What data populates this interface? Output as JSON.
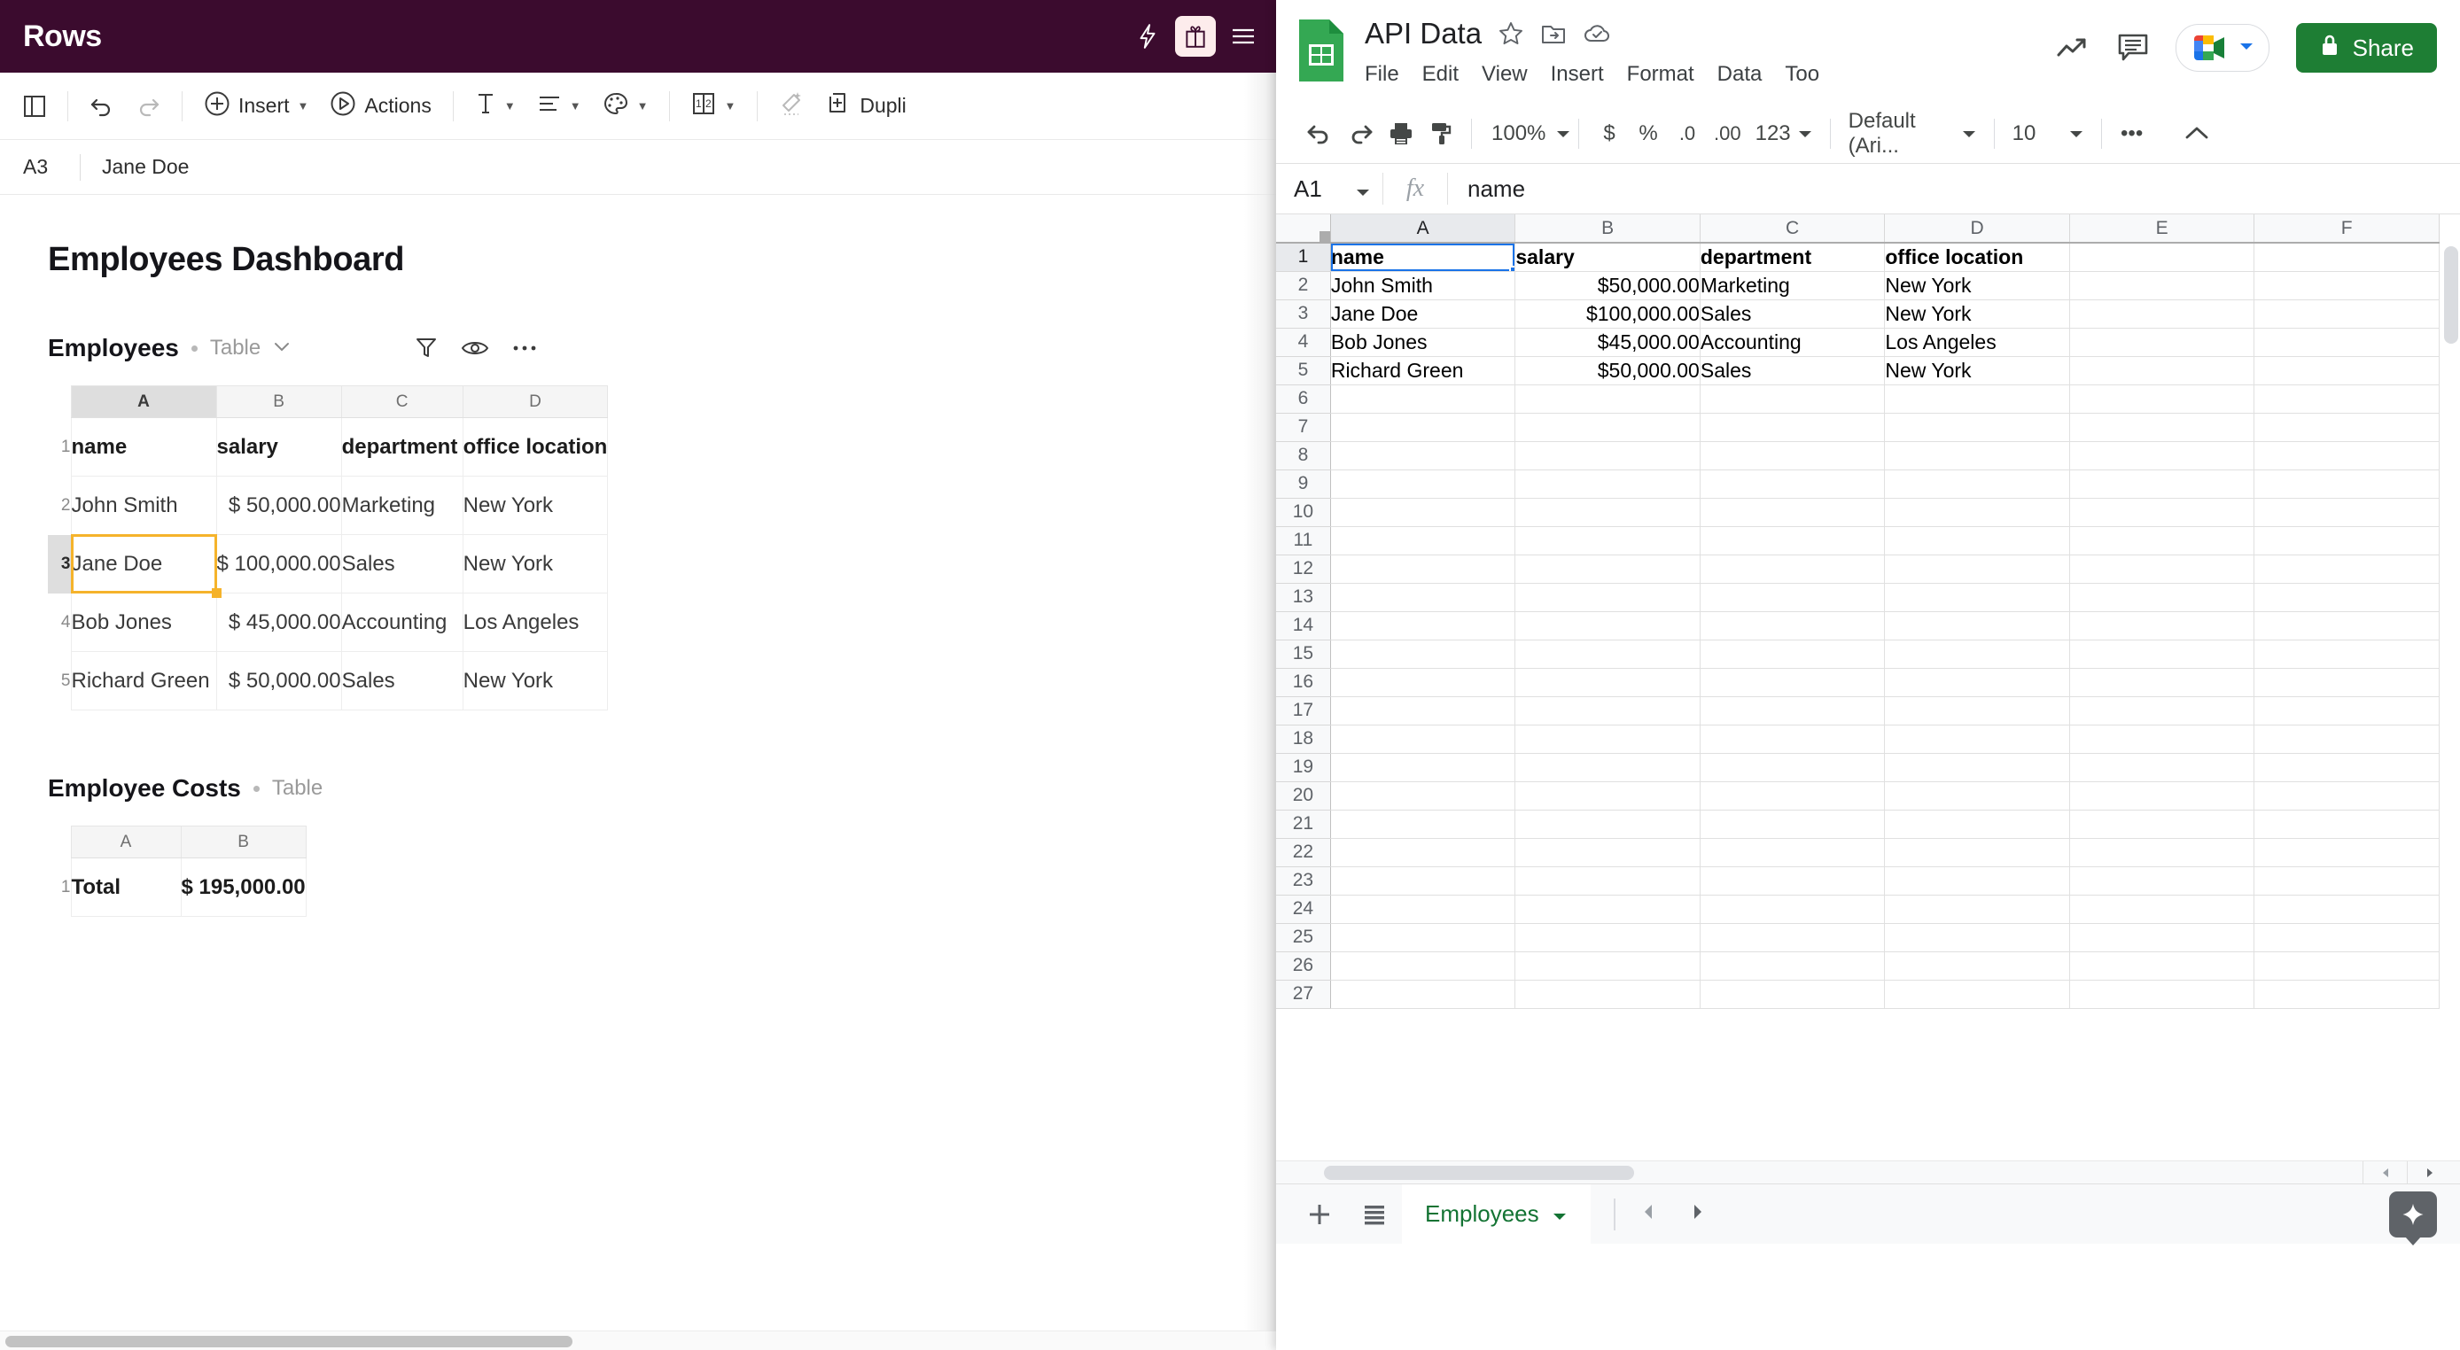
{
  "rows_app": {
    "brand": "Rows",
    "topbar_icons": [
      "lightning-icon",
      "gift-icon",
      "hamburger-menu-icon"
    ],
    "toolbar": {
      "panel_label": "",
      "undo_label": "",
      "redo_label": "",
      "insert_label": "Insert",
      "actions_label": "Actions",
      "duplicate_label": "Dupli"
    },
    "formula_bar": {
      "cell_ref": "A3",
      "value": "Jane Doe"
    },
    "page_title": "Employees Dashboard",
    "sections": [
      {
        "title": "Employees",
        "type_label": "Table",
        "has_caret": true,
        "actions": [
          "filter-icon",
          "eye-icon",
          "more-options-icon"
        ],
        "columns": [
          "A",
          "B",
          "C",
          "D"
        ],
        "active_column": "A",
        "active_row": "3",
        "rows": [
          {
            "n": "1",
            "cells": [
              "name",
              "salary",
              "department",
              "office location"
            ],
            "header": true
          },
          {
            "n": "2",
            "cells": [
              "John Smith",
              "$ 50,000.00",
              "Marketing",
              "New York"
            ]
          },
          {
            "n": "3",
            "cells": [
              "Jane Doe",
              "$ 100,000.00",
              "Sales",
              "New York"
            ],
            "selected_col": 0
          },
          {
            "n": "4",
            "cells": [
              "Bob Jones",
              "$ 45,000.00",
              "Accounting",
              "Los Angeles"
            ]
          },
          {
            "n": "5",
            "cells": [
              "Richard Green",
              "$ 50,000.00",
              "Sales",
              "New York"
            ]
          }
        ]
      },
      {
        "title": "Employee Costs",
        "type_label": "Table",
        "has_caret": false,
        "columns": [
          "A",
          "B"
        ],
        "rows": [
          {
            "n": "1",
            "cells": [
              "Total",
              "$ 195,000.00"
            ],
            "header": true
          }
        ]
      }
    ]
  },
  "google_sheets": {
    "doc_title": "API Data",
    "title_icons": [
      "star-icon",
      "move-to-folder-icon",
      "cloud-saved-icon"
    ],
    "menus": [
      "File",
      "Edit",
      "View",
      "Insert",
      "Format",
      "Data",
      "Too"
    ],
    "header_right": {
      "trends_icon": "trends-icon",
      "comment_icon": "comment-icon",
      "meet_icon": "google-meet-icon",
      "share_label": "Share"
    },
    "toolbar": {
      "zoom": "100%",
      "currency": "$",
      "percent": "%",
      "decrease_decimal": ".0",
      "increase_decimal": ".00",
      "more_formats": "123",
      "font": "Default (Ari...",
      "font_size": "10",
      "more_label": "•••"
    },
    "formula_bar": {
      "name_box": "A1",
      "fx_label": "fx",
      "value": "name"
    },
    "grid": {
      "columns": [
        "A",
        "B",
        "C",
        "D",
        "E",
        "F"
      ],
      "active_column": "A",
      "active_row": "1",
      "row_numbers": [
        "1",
        "2",
        "3",
        "4",
        "5",
        "6",
        "7",
        "8",
        "9",
        "10",
        "11",
        "12",
        "13",
        "14",
        "15",
        "16",
        "17",
        "18",
        "19",
        "20",
        "21",
        "22",
        "23",
        "24",
        "25",
        "26",
        "27"
      ],
      "rows": [
        {
          "n": "1",
          "cells": [
            "name",
            "salary",
            "department",
            "office location",
            "",
            ""
          ],
          "header": true,
          "selected_col": 0
        },
        {
          "n": "2",
          "cells": [
            "John Smith",
            "$50,000.00",
            "Marketing",
            "New York",
            "",
            ""
          ]
        },
        {
          "n": "3",
          "cells": [
            "Jane Doe",
            "$100,000.00",
            "Sales",
            "New York",
            "",
            ""
          ]
        },
        {
          "n": "4",
          "cells": [
            "Bob Jones",
            "$45,000.00",
            "Accounting",
            "Los Angeles",
            "",
            ""
          ]
        },
        {
          "n": "5",
          "cells": [
            "Richard Green",
            "$50,000.00",
            "Sales",
            "New York",
            "",
            ""
          ]
        }
      ]
    },
    "sheet_bar": {
      "add_label": "+",
      "all_sheets_icon": "sheet-list-icon",
      "tab_name": "Employees",
      "prev_icon": "prev-arrow-icon",
      "next_icon": "next-arrow-icon",
      "explore_icon": "explore-sparkle-icon"
    }
  },
  "colors": {
    "rows_brand": "#3B0B2E",
    "rows_selection": "#F5B32B",
    "sheets_green": "#1E7E34",
    "sheets_selection": "#1A73E8",
    "sheets_tab_green": "#137333"
  }
}
